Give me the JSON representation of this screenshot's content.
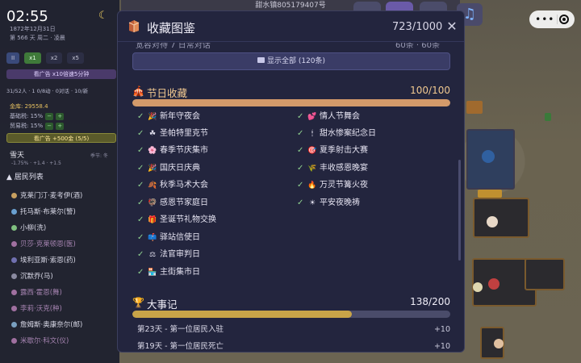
{
  "hud": {
    "time": "02:55",
    "date": "1872年12月31日",
    "meta": "第 566 天 周二 · 凌晨",
    "speed": {
      "pause": "II",
      "x1": "x1",
      "x2": "x2",
      "x5": "x5"
    },
    "ad_speed": "看广告 x10倍速5分钟",
    "stats": "31/52人 · 1 0/8动 · 0对话 · 10/新",
    "money": "金库: 29558.4",
    "tax1": "基础税: 15%",
    "tax2": "贸易税: 15%",
    "ad_gold": "看广告 +500金 (5/5)",
    "weather": "雪天",
    "weather_sub": "-1.75% · +1.4 · +1.5",
    "season": "季节: 冬",
    "residents_header": "居民列表",
    "residents": [
      {
        "name": "克莱门汀·麦考伊(酒)",
        "color": "#c8a060",
        "dim": false
      },
      {
        "name": "托马斯·布莱尔(警)",
        "color": "#6aa0d0",
        "dim": false
      },
      {
        "name": "小柳(洗)",
        "color": "#80c080",
        "dim": false
      },
      {
        "name": "贝莎·克莱顿恩(医)",
        "color": "#a070a0",
        "dim": true
      },
      {
        "name": "埃利亚斯·索恩(药)",
        "color": "#7070b0",
        "dim": false
      },
      {
        "name": "沉默乔(马)",
        "color": "#8a8aa0",
        "dim": false
      },
      {
        "name": "露西·霍恩(舞)",
        "color": "#a070a0",
        "dim": true
      },
      {
        "name": "李莉·沃克(种)",
        "color": "#a070a0",
        "dim": true
      },
      {
        "name": "詹姆斯·奥康奈尔(邮)",
        "color": "#7aa0c0",
        "dim": false
      },
      {
        "name": "米歇尔·科文(仪)",
        "color": "#a070a0",
        "dim": true
      }
    ]
  },
  "topbar": {
    "label": "甜水镇805179407号"
  },
  "modal": {
    "title": "收藏图鉴",
    "count": "723/1000",
    "prev_row_left": "宽容对待 7 日常对话",
    "prev_row_right": "60条 · 60条",
    "show_all": "显示全部 (120条)",
    "festival": {
      "title": "节日收藏",
      "count": "100/100",
      "progress": 1.0,
      "items_left": [
        {
          "icon": "🎉",
          "label": "新年守夜会"
        },
        {
          "icon": "☘",
          "label": "圣帕特里克节"
        },
        {
          "icon": "🌸",
          "label": "春季节庆集市"
        },
        {
          "icon": "🎉",
          "label": "国庆日庆典"
        },
        {
          "icon": "🍂",
          "label": "秋季马术大会"
        },
        {
          "icon": "🦃",
          "label": "感恩节家庭日"
        },
        {
          "icon": "🎁",
          "label": "圣诞节礼物交换"
        },
        {
          "icon": "📫",
          "label": "驿站信使日"
        },
        {
          "icon": "⚖",
          "label": "法官审判日"
        },
        {
          "icon": "🏪",
          "label": "主街集市日"
        }
      ],
      "items_right": [
        {
          "icon": "💕",
          "label": "情人节舞会"
        },
        {
          "icon": "🕯",
          "label": "甜水惨案纪念日"
        },
        {
          "icon": "🎯",
          "label": "夏季射击大赛"
        },
        {
          "icon": "🌾",
          "label": "丰收感恩晚宴"
        },
        {
          "icon": "🔥",
          "label": "万灵节篝火夜"
        },
        {
          "icon": "☀",
          "label": "平安夜晚祷"
        }
      ]
    },
    "events": {
      "title": "大事记",
      "count": "138/200",
      "progress": 0.69,
      "rows": [
        {
          "label": "第23天 - 第一位居民入驻",
          "points": "+10"
        },
        {
          "label": "第19天 - 第一位居民死亡",
          "points": "+10"
        }
      ]
    }
  },
  "colors": {
    "festival_bar": "#d39a6a",
    "events_bar": "#c8a448",
    "check": "#8fd08f"
  }
}
